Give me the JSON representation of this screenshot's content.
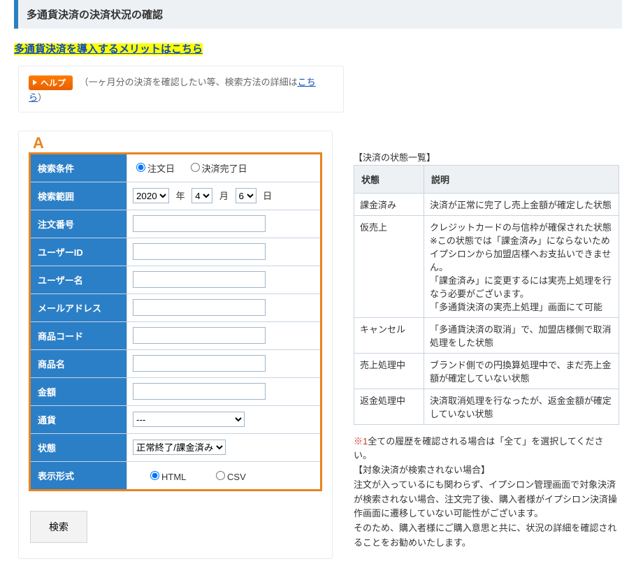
{
  "header": {
    "title": "多通貨決済の決済状況の確認"
  },
  "merit_link": {
    "text": "多通貨決済を導入するメリットはこちら"
  },
  "help": {
    "button_label": "ヘルプ",
    "text_prefix": "（一ヶ月分の決済を確認したい等、検索方法の詳細は",
    "link_text": "こちら",
    "text_suffix": "）"
  },
  "marker": "A",
  "search_form": {
    "rows": {
      "condition": {
        "label": "検索条件",
        "radio1": "注文日",
        "radio2": "決済完了日"
      },
      "range": {
        "label": "検索範囲",
        "year": "2020",
        "year_suffix": "年",
        "month": "4",
        "month_suffix": "月",
        "day": "6",
        "day_suffix": "日"
      },
      "order_no": {
        "label": "注文番号"
      },
      "user_id": {
        "label": "ユーザーID"
      },
      "user_name": {
        "label": "ユーザー名"
      },
      "email": {
        "label": "メールアドレス"
      },
      "item_code": {
        "label": "商品コード"
      },
      "item_name": {
        "label": "商品名"
      },
      "amount": {
        "label": "金額"
      },
      "currency": {
        "label": "通貨",
        "selected": "---"
      },
      "status": {
        "label": "状態",
        "selected": "正常終了/課金済み"
      },
      "format": {
        "label": "表示形式",
        "radio_html": "HTML",
        "radio_csv": "CSV"
      }
    },
    "submit_label": "検索"
  },
  "status_table": {
    "caption": "【決済の状態一覧】",
    "header_state": "状態",
    "header_desc": "説明",
    "rows": [
      {
        "name": "課金済み",
        "desc": "決済が正常に完了し売上金額が確定した状態"
      },
      {
        "name": "仮売上",
        "desc": "クレジットカードの与信枠が確保された状態\n※この状態では「課金済み」にならないためイプシロンから加盟店様へお支払いできません。\n「課金済み」に変更するには実売上処理を行なう必要がございます。\n「多通貨決済の実売上処理」画面にて可能"
      },
      {
        "name": "キャンセル",
        "desc": "「多通貨決済の取消」で、加盟店様側で取消処理をした状態"
      },
      {
        "name": "売上処理中",
        "desc": "ブランド側での円換算処理中で、まだ売上金額が確定していない状態"
      },
      {
        "name": "返金処理中",
        "desc": "決済取消処理を行なったが、返金金額が確定していない状態"
      }
    ]
  },
  "notes": {
    "line1_prefix": "※1",
    "line1": "全ての履歴を確認される場合は「全て」を選択してください。",
    "line2": "【対象決済が検索されない場合】",
    "line3": "注文が入っているにも関わらず、イプシロン管理画面で対象決済が検索されない場合、注文完了後、購入者様がイプシロン決済操作画面に遷移していない可能性がございます。",
    "line4": "そのため、購入者様にご購入意思と共に、状況の詳細を確認されることをお勧めいたします。"
  }
}
